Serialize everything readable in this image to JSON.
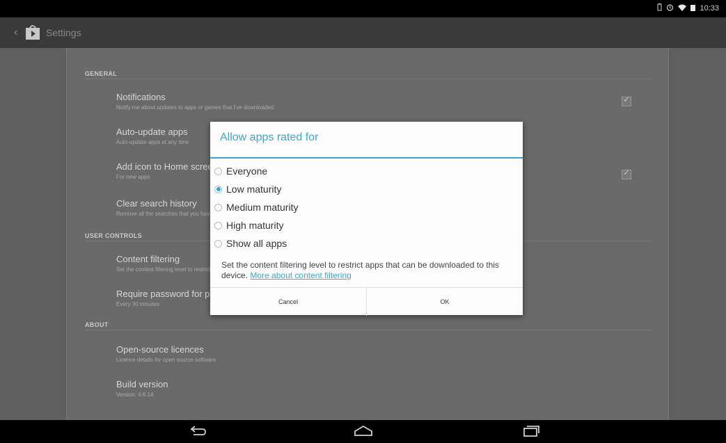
{
  "status_bar": {
    "time": "10:33"
  },
  "action_bar": {
    "title": "Settings"
  },
  "sections": {
    "general": {
      "title": "GENERAL",
      "items": [
        {
          "title": "Notifications",
          "subtitle": "Notify me about updates to apps or games that I've downloaded",
          "checked": true
        },
        {
          "title": "Auto-update apps",
          "subtitle": "Auto-update apps at any time"
        },
        {
          "title": "Add icon to Home screen",
          "subtitle": "For new apps",
          "checked": true
        },
        {
          "title": "Clear search history",
          "subtitle": "Remove all the searches that you have performed"
        }
      ]
    },
    "user_controls": {
      "title": "USER CONTROLS",
      "items": [
        {
          "title": "Content filtering",
          "subtitle": "Set the content filtering level to restrict apps"
        },
        {
          "title": "Require password for purchases",
          "subtitle": "Every 30 minutes"
        }
      ]
    },
    "about": {
      "title": "ABOUT",
      "items": [
        {
          "title": "Open-source licences",
          "subtitle": "Licence details for open source software"
        },
        {
          "title": "Build version",
          "subtitle": "Version: 4.6.14"
        }
      ]
    }
  },
  "dialog": {
    "title": "Allow apps rated for",
    "options": [
      {
        "label": "Everyone",
        "selected": false
      },
      {
        "label": "Low maturity",
        "selected": true
      },
      {
        "label": "Medium maturity",
        "selected": false
      },
      {
        "label": "High maturity",
        "selected": false
      },
      {
        "label": "Show all apps",
        "selected": false
      }
    ],
    "description": "Set the content filtering level to restrict apps that can be downloaded to this device.",
    "link": "More about content filtering",
    "cancel": "Cancel",
    "ok": "OK"
  },
  "colors": {
    "accent": "#3ea6cc",
    "status_bar": "#000000",
    "action_bar": "#3a3a3a"
  },
  "icons": [
    "battery-icon",
    "alarm-icon",
    "wifi-icon",
    "signal-icon",
    "play-store-icon",
    "back-nav-icon",
    "home-nav-icon",
    "recents-nav-icon"
  ]
}
